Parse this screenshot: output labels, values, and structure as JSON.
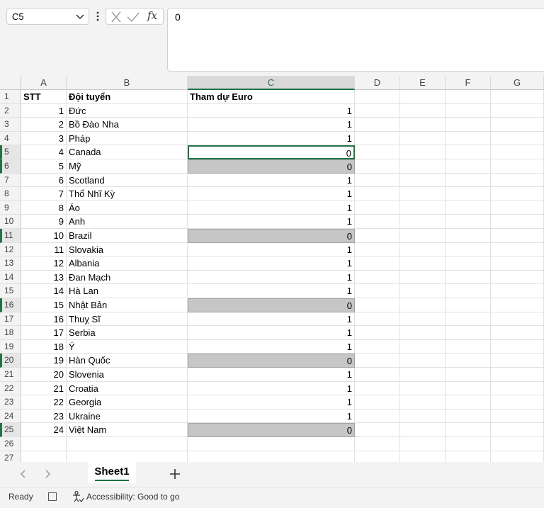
{
  "formula_bar": {
    "name_box": "C5",
    "formula_value": "0",
    "fx_label": "fx"
  },
  "columns": [
    "A",
    "B",
    "C",
    "D",
    "E",
    "F",
    "G"
  ],
  "selected_column": "C",
  "header_row": {
    "a": "STT",
    "b": "Đội tuyển",
    "c": "Tham dự Euro"
  },
  "rows": [
    {
      "n": "1",
      "stt": "1",
      "team": "Đức",
      "euro": "1"
    },
    {
      "n": "2",
      "stt": "2",
      "team": "Bồ Đào Nha",
      "euro": "1"
    },
    {
      "n": "3",
      "stt": "3",
      "team": "Pháp",
      "euro": "1"
    },
    {
      "n": "4",
      "stt": "4",
      "team": "Canada",
      "euro": "0"
    },
    {
      "n": "5",
      "stt": "5",
      "team": "Mỹ",
      "euro": "0"
    },
    {
      "n": "6",
      "stt": "6",
      "team": "Scotland",
      "euro": "1"
    },
    {
      "n": "7",
      "stt": "7",
      "team": "Thổ Nhĩ Kỳ",
      "euro": "1"
    },
    {
      "n": "8",
      "stt": "8",
      "team": "Áo",
      "euro": "1"
    },
    {
      "n": "9",
      "stt": "9",
      "team": "Anh",
      "euro": "1"
    },
    {
      "n": "10",
      "stt": "10",
      "team": "Brazil",
      "euro": "0"
    },
    {
      "n": "11",
      "stt": "11",
      "team": "Slovakia",
      "euro": "1"
    },
    {
      "n": "12",
      "stt": "12",
      "team": "Albania",
      "euro": "1"
    },
    {
      "n": "13",
      "stt": "13",
      "team": "Đan Mạch",
      "euro": "1"
    },
    {
      "n": "14",
      "stt": "14",
      "team": "Hà Lan",
      "euro": "1"
    },
    {
      "n": "15",
      "stt": "15",
      "team": "Nhật Bản",
      "euro": "0"
    },
    {
      "n": "16",
      "stt": "16",
      "team": "Thuỵ Sĩ",
      "euro": "1"
    },
    {
      "n": "17",
      "stt": "17",
      "team": "Serbia",
      "euro": "1"
    },
    {
      "n": "18",
      "stt": "18",
      "team": "Ý",
      "euro": "1"
    },
    {
      "n": "19",
      "stt": "19",
      "team": "Hàn Quốc",
      "euro": "0"
    },
    {
      "n": "20",
      "stt": "20",
      "team": "Slovenia",
      "euro": "1"
    },
    {
      "n": "21",
      "stt": "21",
      "team": "Croatia",
      "euro": "1"
    },
    {
      "n": "22",
      "stt": "22",
      "team": "Georgia",
      "euro": "1"
    },
    {
      "n": "23",
      "stt": "23",
      "team": "Ukraine",
      "euro": "1"
    },
    {
      "n": "24",
      "stt": "24",
      "team": "Việt Nam",
      "euro": "0"
    }
  ],
  "row_numbers": [
    "1",
    "2",
    "3",
    "4",
    "5",
    "6",
    "7",
    "8",
    "9",
    "10",
    "11",
    "12",
    "13",
    "14",
    "15",
    "16",
    "17",
    "18",
    "19",
    "20",
    "21",
    "22",
    "23",
    "24",
    "25",
    "26",
    "27"
  ],
  "selected_rows": [
    "5",
    "6",
    "11",
    "16",
    "20",
    "25"
  ],
  "active_cell_row": "5",
  "sheet_tab": "Sheet1",
  "status": {
    "ready": "Ready",
    "accessibility": "Accessibility: Good to go"
  },
  "colors": {
    "accent": "#217346",
    "highlight_fill": "#c6c6c6"
  },
  "icons": [
    "chevron-down-icon",
    "more-vertical-icon",
    "cancel-icon",
    "check-icon",
    "prev-sheet-icon",
    "next-sheet-icon",
    "add-sheet-icon",
    "accessibility-icon"
  ]
}
